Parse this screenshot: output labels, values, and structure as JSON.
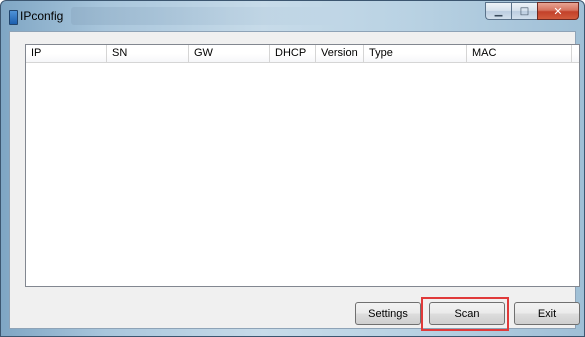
{
  "window": {
    "title": "IPconfig",
    "minimize_glyph": "▁",
    "maximize_glyph": "□",
    "close_glyph": "✕"
  },
  "list": {
    "columns": [
      "IP",
      "SN",
      "GW",
      "DHCP",
      "Version",
      "Type",
      "MAC"
    ],
    "rows": []
  },
  "buttons": {
    "settings": "Settings",
    "scan": "Scan",
    "exit": "Exit"
  },
  "colors": {
    "highlight": "#e03a3a",
    "close_button": "#c2412a",
    "titlebar": "#a9c6dc"
  },
  "icons": {
    "app": "app-icon",
    "minimize": "minimize-icon",
    "maximize": "maximize-icon",
    "close": "close-icon"
  }
}
